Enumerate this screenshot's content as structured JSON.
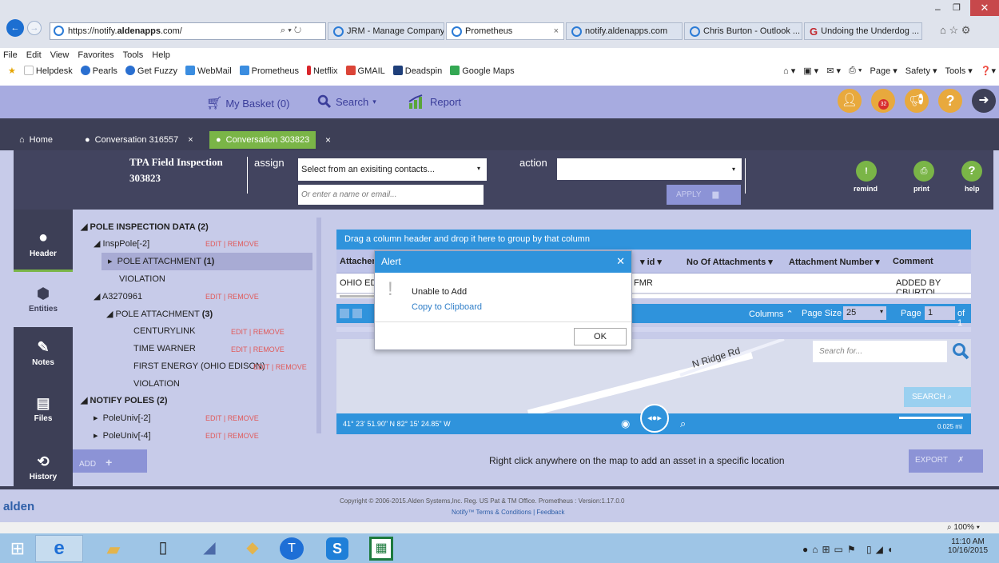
{
  "browser": {
    "address_url": "https://notify.aldenapps.com/",
    "address_domain_bold": "aldenapps",
    "tabs": [
      {
        "label": "JRM - Manage Company"
      },
      {
        "label": "Prometheus",
        "active": true
      },
      {
        "label": "notify.aldenapps.com"
      },
      {
        "label": "Chris Burton - Outlook ..."
      },
      {
        "label": "Undoing the Underdog ..."
      }
    ],
    "menu": [
      "File",
      "Edit",
      "View",
      "Favorites",
      "Tools",
      "Help"
    ],
    "favorites": [
      "Helpdesk",
      "Pearls",
      "Get Fuzzy",
      "WebMail",
      "Prometheus",
      "Netflix",
      "GMAIL",
      "Deadspin",
      "Google Maps"
    ],
    "command_items": [
      "Page",
      "Safety",
      "Tools"
    ],
    "zoom": "100%"
  },
  "app": {
    "toolbar": {
      "basket": "My Basket (0)",
      "search": "Search",
      "report": "Report"
    },
    "alert_badge": "32",
    "conv_tabs": [
      {
        "label": "Home"
      },
      {
        "label": "Conversation 316557"
      },
      {
        "label": "Conversation 303823",
        "active": true
      }
    ],
    "header": {
      "title": "TPA Field Inspection",
      "number": "303823",
      "assign_label": "assign",
      "contacts_placeholder": "Select from an exisiting contacts...",
      "name_placeholder": "Or enter a name or email...",
      "action_label": "action",
      "apply": "APPLY",
      "remind": "remind",
      "print": "print",
      "help": "help"
    },
    "sidebar": [
      {
        "label": "Header"
      },
      {
        "label": "Entities",
        "active": true
      },
      {
        "label": "Notes"
      },
      {
        "label": "Files"
      },
      {
        "label": "History"
      }
    ],
    "tree": {
      "edit": "EDIT",
      "remove": "REMOVE",
      "n1": "POLE INSPECTION DATA",
      "n1_count": "(2)",
      "n2": "InspPole[-2]",
      "n3": "POLE ATTACHMENT",
      "n3_count": "(1)",
      "n4": "VIOLATION",
      "n5": "A3270961",
      "n6": "POLE ATTACHMENT",
      "n6_count": "(3)",
      "n7": "CENTURYLINK",
      "n8": "TIME WARNER",
      "n9": "FIRST ENERGY (OHIO EDISON)",
      "n10": "VIOLATION",
      "n11": "NOTIFY POLES",
      "n11_count": "(2)",
      "n12": "PoleUniv[-2]",
      "n13": "PoleUniv[-4]"
    },
    "grid": {
      "group_hint": "Drag a column header and drop it here to group by that column",
      "columns": [
        "Attacher",
        "id",
        "No Of Attachments",
        "Attachment Number",
        "Comment"
      ],
      "row": {
        "attacher": "OHIO ED",
        "id": "FMR",
        "comment": "ADDED BY CBURTOI"
      },
      "columns_label": "Columns",
      "page_size_label": "Page Size",
      "page_size": "25",
      "page_label": "Page",
      "page": "1",
      "of": "of 1"
    },
    "map": {
      "street": "N Ridge Rd",
      "search_placeholder": "Search for...",
      "search_btn": "SEARCH",
      "coords": "41° 23' 51.90\" N 82° 15' 24.85\" W",
      "scale": "0.025 mi"
    },
    "bottom": {
      "add": "ADD",
      "hint": "Right click anywhere on the map to add an asset in a specific location",
      "export": "EXPORT"
    },
    "footer": {
      "logo": "alden",
      "copyright": "Copyright © 2006-2015.Alden Systems,Inc. Reg. US Pat & TM Office. Prometheus : Version:1.17.0.0",
      "links": "Notify™ Terms & Conditions | Feedback"
    }
  },
  "dialog": {
    "title": "Alert",
    "message": "Unable to Add",
    "copy": "Copy to Clipboard",
    "ok": "OK"
  },
  "taskbar": {
    "time": "11:10 AM",
    "date": "10/16/2015"
  }
}
